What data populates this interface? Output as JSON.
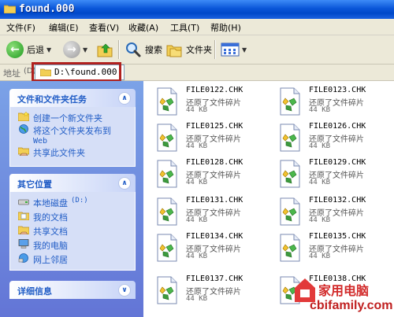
{
  "window": {
    "title": "found.000"
  },
  "menu": [
    {
      "label": "文件(F)"
    },
    {
      "label": "编辑(E)"
    },
    {
      "label": "查看(V)"
    },
    {
      "label": "收藏(A)"
    },
    {
      "label": "工具(T)"
    },
    {
      "label": "帮助(H)"
    }
  ],
  "toolbar": {
    "back_label": "后退",
    "search_label": "搜索",
    "folders_label": "文件夹"
  },
  "address": {
    "label": "地址",
    "label_key": "(D)",
    "value": "D:\\found.000"
  },
  "tasks_panel": {
    "title": "文件和文件夹任务",
    "items": [
      {
        "label": "创建一个新文件夹",
        "icon": "new-folder-icon"
      },
      {
        "label": "将这个文件夹发布到",
        "label2": "Web",
        "icon": "publish-web-icon"
      },
      {
        "label": "共享此文件夹",
        "icon": "share-folder-icon"
      }
    ]
  },
  "places_panel": {
    "title": "其它位置",
    "items": [
      {
        "label": "本地磁盘",
        "suffix": "(D:)",
        "icon": "local-disk-icon"
      },
      {
        "label": "我的文档",
        "icon": "my-documents-icon"
      },
      {
        "label": "共享文档",
        "icon": "shared-documents-icon"
      },
      {
        "label": "我的电脑",
        "icon": "my-computer-icon"
      },
      {
        "label": "网上邻居",
        "icon": "network-places-icon"
      }
    ]
  },
  "details_panel": {
    "title": "详细信息"
  },
  "files": [
    {
      "name": "FILE0122.CHK",
      "desc": "还原了文件碎片",
      "size": "44 KB"
    },
    {
      "name": "FILE0123.CHK",
      "desc": "还原了文件碎片",
      "size": "44 KB"
    },
    {
      "name": "FILE0125.CHK",
      "desc": "还原了文件碎片",
      "size": "44 KB"
    },
    {
      "name": "FILE0126.CHK",
      "desc": "还原了文件碎片",
      "size": "44 KB"
    },
    {
      "name": "FILE0128.CHK",
      "desc": "还原了文件碎片",
      "size": "44 KB"
    },
    {
      "name": "FILE0129.CHK",
      "desc": "还原了文件碎片",
      "size": "44 KB"
    },
    {
      "name": "FILE0131.CHK",
      "desc": "还原了文件碎片",
      "size": "44 KB"
    },
    {
      "name": "FILE0132.CHK",
      "desc": "还原了文件碎片",
      "size": "44 KB"
    },
    {
      "name": "FILE0134.CHK",
      "desc": "还原了文件碎片",
      "size": "44 KB"
    },
    {
      "name": "FILE0135.CHK",
      "desc": "还原了文件碎片",
      "size": "44 KB"
    },
    {
      "name": "FILE0137.CHK",
      "desc": "还原了文件碎片",
      "size": "44 KB"
    },
    {
      "name": "FILE0138.CHK",
      "desc": "",
      "size": ""
    }
  ],
  "watermark": {
    "brand": "家用电脑",
    "url": "cbifamily.com"
  },
  "colors": {
    "titlebar": "#0a56d8",
    "link": "#215dc6",
    "highlight": "#b0201e"
  }
}
